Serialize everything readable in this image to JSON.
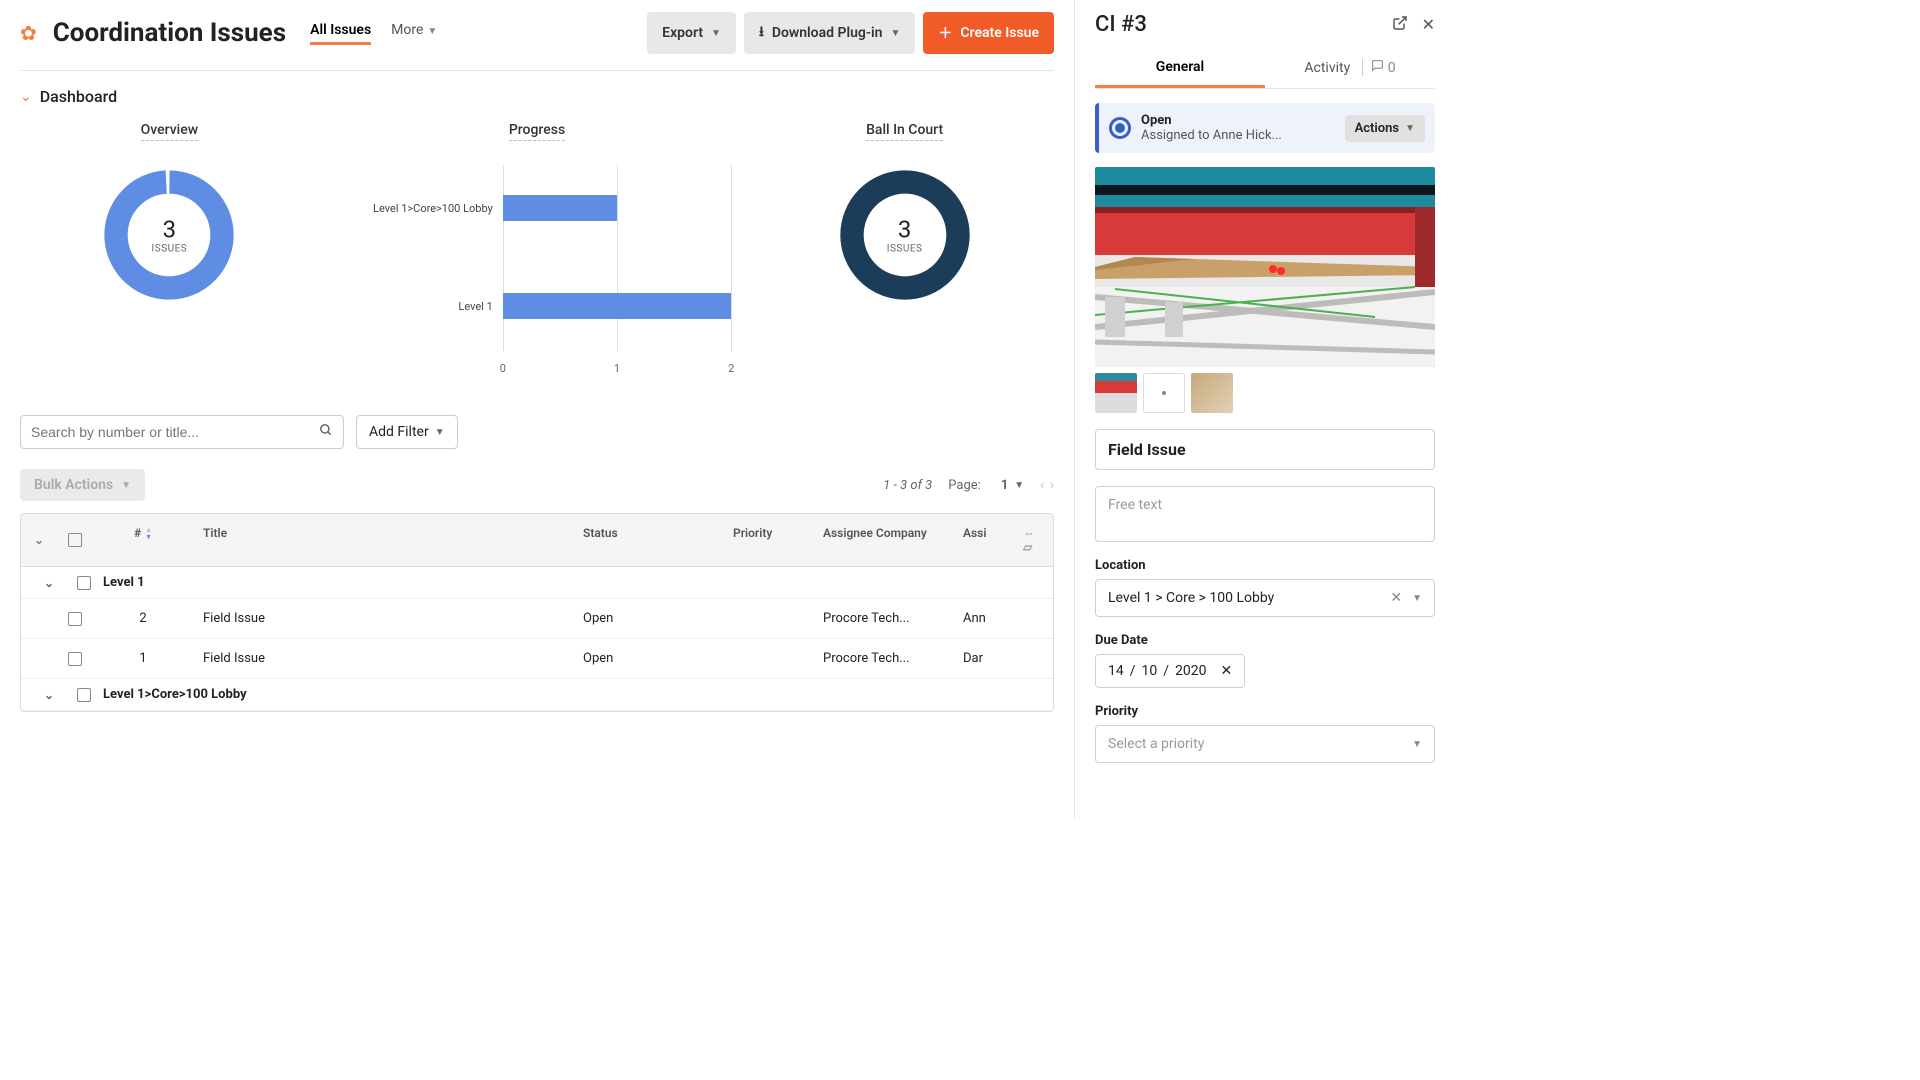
{
  "header": {
    "title": "Coordination Issues",
    "tabs": {
      "all_issues": "All Issues",
      "more": "More"
    },
    "export": "Export",
    "download": "Download Plug-in",
    "create": "Create Issue"
  },
  "dashboard": {
    "label": "Dashboard",
    "overview": {
      "title": "Overview",
      "count": "3",
      "unit": "ISSUES"
    },
    "progress": {
      "title": "Progress"
    },
    "ball": {
      "title": "Ball In Court",
      "count": "3",
      "unit": "ISSUES"
    }
  },
  "chart_data": {
    "type": "bar",
    "title": "Progress",
    "orientation": "horizontal",
    "xlabel": "",
    "ylabel": "",
    "xlim": [
      0,
      2
    ],
    "xticks": [
      0,
      1,
      2
    ],
    "categories": [
      "Level 1>Core>100 Lobby",
      "Level 1"
    ],
    "values": [
      1,
      2
    ]
  },
  "filters": {
    "search_placeholder": "Search by number or title...",
    "add_filter": "Add Filter"
  },
  "toolbar": {
    "bulk_actions": "Bulk Actions",
    "range": "1 - 3 of 3",
    "page_label": "Page:",
    "page_value": "1"
  },
  "table": {
    "headers": {
      "num": "#",
      "title": "Title",
      "status": "Status",
      "priority": "Priority",
      "assignee_company": "Assignee Company",
      "assignee": "Assi"
    },
    "groups": [
      {
        "name": "Level 1",
        "rows": [
          {
            "num": "2",
            "title": "Field Issue",
            "status": "Open",
            "company": "Procore Tech...",
            "assignee": "Ann"
          },
          {
            "num": "1",
            "title": "Field Issue",
            "status": "Open",
            "company": "Procore Tech...",
            "assignee": "Dar"
          }
        ]
      },
      {
        "name": "Level 1>Core>100 Lobby",
        "rows": []
      }
    ]
  },
  "sidebar": {
    "title": "CI #3",
    "tabs": {
      "general": "General",
      "activity": "Activity",
      "activity_count": "0"
    },
    "status": {
      "open": "Open",
      "assigned": "Assigned to Anne Hick...",
      "actions": "Actions"
    },
    "issue_title": "Field Issue",
    "free_text_placeholder": "Free text",
    "location": {
      "label": "Location",
      "value": "Level 1 > Core > 100 Lobby"
    },
    "due_date": {
      "label": "Due Date",
      "dd": "14",
      "mm": "10",
      "yyyy": "2020"
    },
    "priority": {
      "label": "Priority",
      "placeholder": "Select a priority"
    }
  }
}
